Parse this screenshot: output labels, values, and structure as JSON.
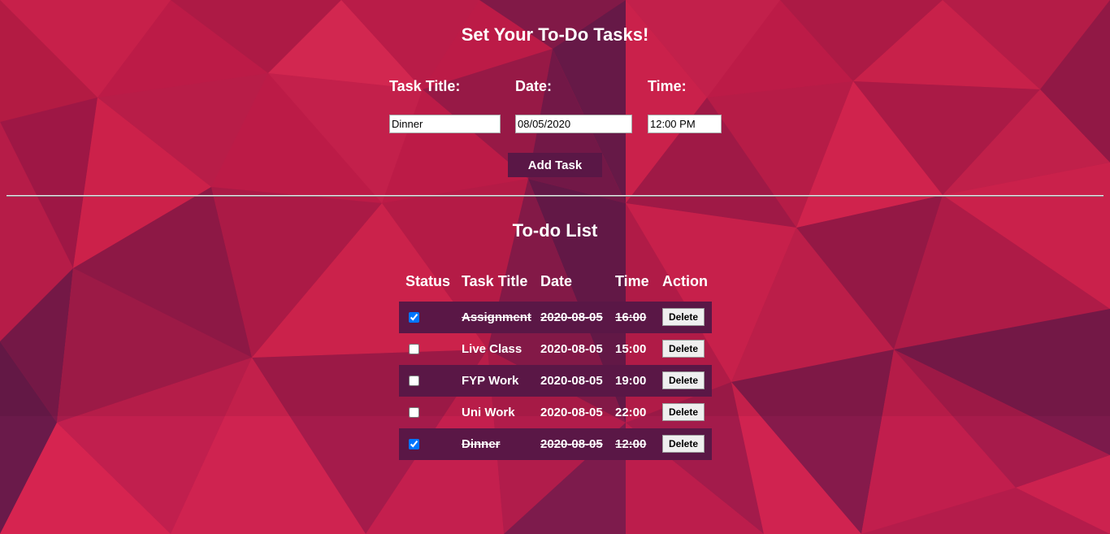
{
  "form": {
    "heading": "Set Your To-Do Tasks!",
    "title_label": "Task Title:",
    "date_label": "Date:",
    "time_label": "Time:",
    "title_value": "Dinner",
    "date_value": "08/05/2020",
    "time_value": "12:00 PM",
    "add_button_label": "Add Task"
  },
  "list": {
    "heading": "To-do List",
    "columns": {
      "status": "Status",
      "title": "Task Title",
      "date": "Date",
      "time": "Time",
      "action": "Action"
    },
    "delete_label": "Delete",
    "tasks": [
      {
        "title": "Assignment",
        "date": "2020-08-05",
        "time": "16:00",
        "done": true
      },
      {
        "title": "Live Class",
        "date": "2020-08-05",
        "time": "15:00",
        "done": false
      },
      {
        "title": "FYP Work",
        "date": "2020-08-05",
        "time": "19:00",
        "done": false
      },
      {
        "title": "Uni Work",
        "date": "2020-08-05",
        "time": "22:00",
        "done": false
      },
      {
        "title": "Dinner",
        "date": "2020-08-05",
        "time": "12:00",
        "done": true
      }
    ]
  },
  "colors": {
    "background_red": "#c81d4c",
    "background_purple": "#6e1b4c",
    "row_shade": "#5a1746",
    "button": "#5a1746",
    "text": "#ffffff"
  }
}
